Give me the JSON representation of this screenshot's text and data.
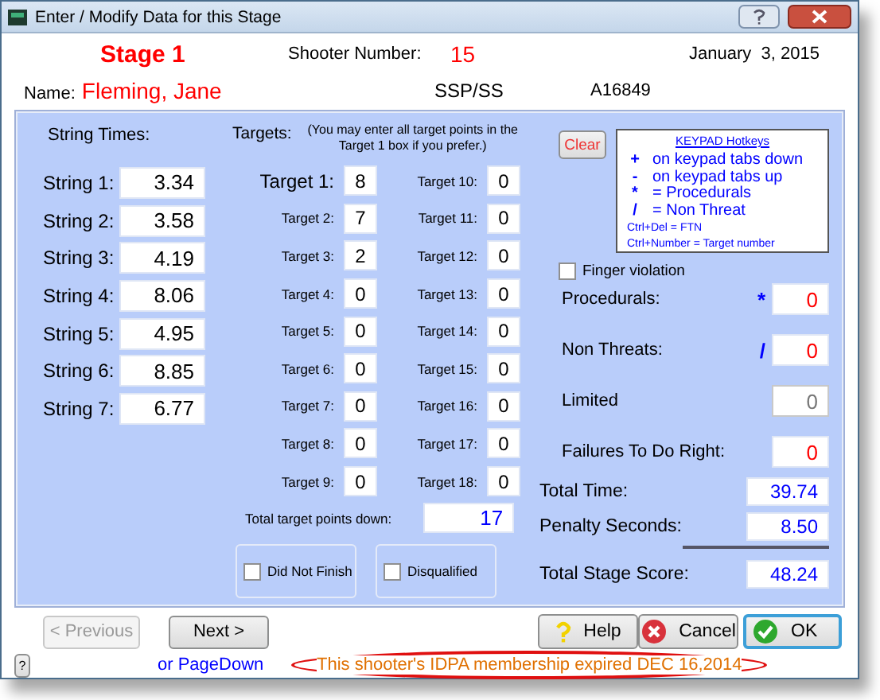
{
  "window": {
    "title": "Enter / Modify Data for this Stage"
  },
  "header": {
    "stage": "Stage 1",
    "shooter_label": "Shooter Number:",
    "shooter_number": "15",
    "date": "January  3, 2015",
    "name_label": "Name:",
    "name": "Fleming, Jane",
    "division": "SSP/SS",
    "member_id": "A16849"
  },
  "strings": {
    "heading": "String Times:",
    "rows": [
      {
        "label": "String 1:",
        "value": "3.34"
      },
      {
        "label": "String 2:",
        "value": "3.58"
      },
      {
        "label": "String 3:",
        "value": "4.19"
      },
      {
        "label": "String 4:",
        "value": "8.06"
      },
      {
        "label": "String 5:",
        "value": "4.95"
      },
      {
        "label": "String 6:",
        "value": "8.85"
      },
      {
        "label": "String 7:",
        "value": "6.77"
      }
    ]
  },
  "targets": {
    "heading": "Targets:",
    "note": "(You may enter all target points in the Target 1 box if you prefer.)",
    "rows": [
      {
        "label": "Target 1:",
        "value": "8"
      },
      {
        "label": "Target 2:",
        "value": "7"
      },
      {
        "label": "Target 3:",
        "value": "2"
      },
      {
        "label": "Target 4:",
        "value": "0"
      },
      {
        "label": "Target 5:",
        "value": "0"
      },
      {
        "label": "Target 6:",
        "value": "0"
      },
      {
        "label": "Target 7:",
        "value": "0"
      },
      {
        "label": "Target 8:",
        "value": "0"
      },
      {
        "label": "Target 9:",
        "value": "0"
      },
      {
        "label": "Target 10:",
        "value": "0"
      },
      {
        "label": "Target 11:",
        "value": "0"
      },
      {
        "label": "Target 12:",
        "value": "0"
      },
      {
        "label": "Target 13:",
        "value": "0"
      },
      {
        "label": "Target 14:",
        "value": "0"
      },
      {
        "label": "Target 15:",
        "value": "0"
      },
      {
        "label": "Target 16:",
        "value": "0"
      },
      {
        "label": "Target 17:",
        "value": "0"
      },
      {
        "label": "Target 18:",
        "value": "0"
      }
    ],
    "total_label": "Total target points down:",
    "total": "17"
  },
  "flags": [
    {
      "label": "Did Not Finish",
      "checked": false
    },
    {
      "label": "Disqualified",
      "checked": false
    }
  ],
  "clear_button": "Clear",
  "hotkeys": {
    "title": "KEYPAD Hotkeys",
    "lines": [
      {
        "key": "+",
        "text": "on keypad tabs down"
      },
      {
        "key": "-",
        "text": "on keypad tabs up"
      },
      {
        "key": "*",
        "text": "= Procedurals"
      },
      {
        "key": "/",
        "text": "= Non Threat"
      }
    ],
    "small_lines": [
      "Ctrl+Del = FTN",
      "Ctrl+Number = Target number"
    ]
  },
  "finger_violation": {
    "label": "Finger violation",
    "checked": false
  },
  "penalties": [
    {
      "label": "Procedurals:",
      "key": "*",
      "value": "0",
      "disabled": false
    },
    {
      "label": "Non Threats:",
      "key": "/",
      "value": "0",
      "disabled": false
    },
    {
      "label": "Limited",
      "value": "0",
      "disabled": true
    },
    {
      "label": "Failures To Do Right:",
      "value": "0",
      "disabled": false
    }
  ],
  "totals": [
    {
      "label": "Total Time:",
      "value": "39.74"
    },
    {
      "label": "Penalty Seconds:",
      "value": "8.50"
    },
    {
      "label": "Total Stage Score:",
      "value": "48.24"
    }
  ],
  "footer": {
    "previous": {
      "label": "< Previous",
      "disabled": true
    },
    "next": "Next >",
    "next_hint": "or PageDown",
    "help": "Help",
    "cancel": "Cancel",
    "ok": "OK",
    "notice": "This shooter's IDPA membership expired DEC 16,2014",
    "help_small": "?"
  }
}
